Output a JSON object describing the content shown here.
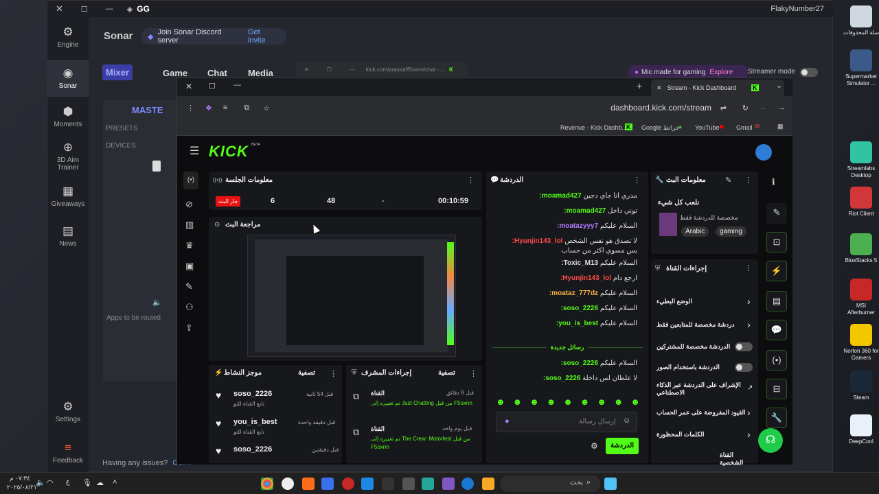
{
  "gg": {
    "logo": "GG",
    "user": "FlakyNumber27",
    "app_title": "Sonar",
    "discord": {
      "label": "Join Sonar Discord server",
      "link": "Get invite"
    },
    "tabs": [
      "Mixer",
      "Game",
      "Chat",
      "Media"
    ],
    "master": "MASTE",
    "presets": "PRESETS",
    "devices": "DEVICES",
    "apps_routed": "Apps to be routed",
    "issues": "Having any issues?",
    "issues_link": "Get h",
    "mic_promo": "Mic made for gaming",
    "explore": "Explore",
    "streamer_mode": "Streamer mode",
    "sidebar": [
      {
        "label": "Engine",
        "icon": "gear-chip-icon"
      },
      {
        "label": "Sonar",
        "icon": "headset-icon"
      },
      {
        "label": "Moments",
        "icon": "hexagon-icon"
      },
      {
        "label": "3D Aim Trainer",
        "icon": "crosshair-icon"
      },
      {
        "label": "Giveaways",
        "icon": "gift-icon"
      },
      {
        "label": "News",
        "icon": "book-icon"
      },
      {
        "label": "Settings",
        "icon": "settings-icon"
      },
      {
        "label": "Feedback",
        "icon": "feedback-icon"
      }
    ],
    "popout_url": "kick.com/popout/f5oxnn/chat - ..."
  },
  "chrome": {
    "tab_title": "Stream - Kick Dashboard",
    "url": "dashboard.kick.com/stream",
    "bookmarks": [
      "Revenue - Kick Dashb...",
      "Google خرائط",
      "YouTube",
      "Gmail"
    ]
  },
  "kick": {
    "logo": "KICK",
    "beta": "BETA",
    "session": {
      "title": "معلومات الجلسة",
      "live": "جار البث",
      "viewers": "6",
      "followers": "48",
      "dash": "-",
      "time": "00:10:59"
    },
    "preview": {
      "title": "مراجعة البث"
    },
    "chat": {
      "title": "الدردشة",
      "new_messages": "رسائل جديدة",
      "placeholder": "إرسال رسالة",
      "send": "الدردشة",
      "messages": [
        {
          "user": "moamad427:",
          "text": "مدري انا جاي دجين",
          "color": "#53fc18"
        },
        {
          "user": "moamad427:",
          "text": "توني داخل",
          "color": "#53fc18"
        },
        {
          "user": "moatazyyy7:",
          "text": "السلام عليكم",
          "color": "#b57dff"
        },
        {
          "user": "Hyunjin143_lol:",
          "text": "لا تصدق هو نفس الشخص",
          "color": "#ff4a4a",
          "extra": "بس مسوي اكثر من حساب"
        },
        {
          "user": "Toxic_M13:",
          "text": "السلام عليكم",
          "color": "#dddddd"
        },
        {
          "user": "Hyunjin143_lol:",
          "text": "ارجع دام",
          "color": "#ff4a4a"
        },
        {
          "user": "moataz_777dz:",
          "text": "السلام عليكم",
          "color": "#ffb347"
        },
        {
          "user": "soso_2226:",
          "text": "السلام عليكم",
          "color": "#53fc18"
        },
        {
          "user": "you_is_best:",
          "text": "السلام عليكم",
          "color": "#53fc18"
        }
      ],
      "after": [
        {
          "user": "soso_2226:",
          "text": "السلام عليكم",
          "color": "#53fc18"
        },
        {
          "user": "soso_2226:",
          "text": "لا علطان لس داخلة",
          "color": "#53fc18"
        }
      ]
    },
    "stream_info": {
      "title": "معلومات البث",
      "name": "نلعب كل شيء",
      "desc": "مخصصة للدردشة فقط",
      "tags": [
        "Arabic",
        "gaming"
      ]
    },
    "channel_actions": {
      "title": "إجراءات القناة",
      "items": [
        "الوضع البطيء",
        "دردشة مخصصة للمتابعين فقط",
        "الدردشة مخصصة للمشتركين",
        "الدردشة باستخدام الصور",
        "الإشراف على الدردشة عبر الذكاء الاصطناعي",
        "القيود المفروضة على عمر الحساب",
        "الكلمات المحظورة",
        "القناة الشخصية"
      ]
    },
    "activity": {
      "title": "موجز النشاط",
      "filter": "تصفية",
      "items": [
        {
          "user": "soso_2226",
          "sub": "تابع القناة للتو",
          "time": "قبل 54 ثانية"
        },
        {
          "user": "you_is_best",
          "sub": "تابع القناة للتو",
          "time": "قبل دقيقة واحدة"
        },
        {
          "user": "soso_2226",
          "sub": "",
          "time": "قبل دقيقتين"
        }
      ]
    },
    "mod": {
      "title": "إجراءات المشرف",
      "filter": "تصفية",
      "items": [
        {
          "label": "القناة",
          "time": "قبل 9 دقائق",
          "text": "تم تغييره إلى Just Chatting من قبل F5oxnn"
        },
        {
          "label": "القناة",
          "time": "قبل يوم واحد",
          "text": "تم تغييره إلى The Crew: Motorfest من قبل F5oxnn"
        }
      ]
    }
  },
  "taskbar": {
    "search": "بحث",
    "time": "٠٧:٣٤ م",
    "date": "٢٠٢٥/٠٨/٢١"
  },
  "desktop": [
    {
      "label": "سلة المحذوفات",
      "color": "#cfd8e0"
    },
    {
      "label": "Supermarket Simulator ...",
      "color": "#3b5a8a"
    },
    {
      "label": "Streamlabs Desktop",
      "color": "#31c3a2"
    },
    {
      "label": "Riot Client",
      "color": "#d13639"
    },
    {
      "label": "BlueStacks 5",
      "color": "#4caf50"
    },
    {
      "label": "MSI Afterburner",
      "color": "#c62828"
    },
    {
      "label": "Norton 360 for Gamers",
      "color": "#f2c700"
    },
    {
      "label": "Steam",
      "color": "#1b2838"
    },
    {
      "label": "DeepCool",
      "color": "#e8f0f8"
    }
  ]
}
